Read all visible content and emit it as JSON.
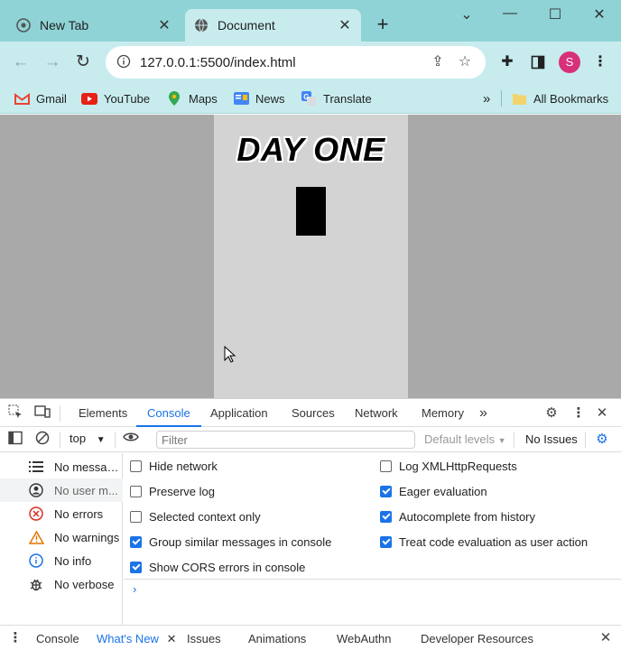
{
  "browser": {
    "tabs": [
      {
        "title": "New Tab",
        "active": false,
        "icon": "chrome-icon"
      },
      {
        "title": "Document",
        "active": true,
        "icon": "globe-icon"
      }
    ],
    "address": "127.0.0.1:5500/index.html",
    "profile_initial": "S",
    "bookmarks": [
      {
        "label": "Gmail",
        "icon": "gmail-icon"
      },
      {
        "label": "YouTube",
        "icon": "youtube-icon"
      },
      {
        "label": "Maps",
        "icon": "maps-icon"
      },
      {
        "label": "News",
        "icon": "news-icon"
      },
      {
        "label": "Translate",
        "icon": "translate-icon"
      }
    ],
    "more_bookmarks": "»",
    "all_bookmarks": "All Bookmarks"
  },
  "page": {
    "heading": "DAY ONE"
  },
  "devtools": {
    "tabs": [
      "Elements",
      "Console",
      "Application",
      "Sources",
      "Network",
      "Memory"
    ],
    "active_tab": "Console",
    "more_tabs": "»",
    "context": "top",
    "filter_placeholder": "Filter",
    "levels": "Default levels",
    "issues": "No Issues",
    "sidebar": [
      {
        "label": "No messag...",
        "icon": "list-icon"
      },
      {
        "label": "No user m...",
        "icon": "user-icon"
      },
      {
        "label": "No errors",
        "icon": "error-icon"
      },
      {
        "label": "No warnings",
        "icon": "warning-icon"
      },
      {
        "label": "No info",
        "icon": "info-icon"
      },
      {
        "label": "No verbose",
        "icon": "bug-icon"
      }
    ],
    "settings_left": [
      {
        "label": "Hide network",
        "checked": false
      },
      {
        "label": "Preserve log",
        "checked": false
      },
      {
        "label": "Selected context only",
        "checked": false
      },
      {
        "label": "Group similar messages in console",
        "checked": true
      },
      {
        "label": "Show CORS errors in console",
        "checked": true
      }
    ],
    "settings_right": [
      {
        "label": "Log XMLHttpRequests",
        "checked": false
      },
      {
        "label": "Eager evaluation",
        "checked": true
      },
      {
        "label": "Autocomplete from history",
        "checked": true
      },
      {
        "label": "Treat code evaluation as user action",
        "checked": true
      }
    ],
    "prompt": "›",
    "drawer_tabs": [
      "Console",
      "What's New",
      "Issues",
      "Animations",
      "WebAuthn",
      "Developer Resources"
    ],
    "drawer_active": "What's New"
  },
  "colors": {
    "tabstrip": "#8fd3d6",
    "toolbar": "#c8ecee",
    "accent": "#1a73e8",
    "avatar": "#d8317a"
  }
}
